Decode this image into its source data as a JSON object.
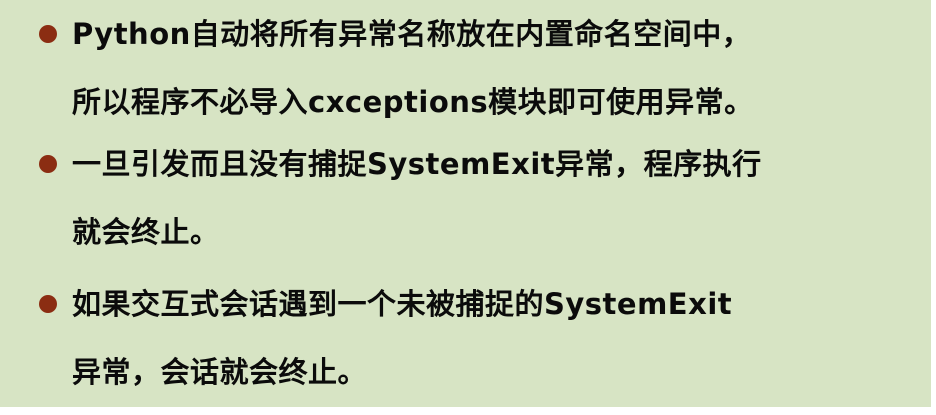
{
  "bullets": [
    {
      "line1": "Python自动将所有异常名称放在内置命名空间中，",
      "line2": "所以程序不必导入cxceptions模块即可使用异常。"
    },
    {
      "line1": "一旦引发而且没有捕捉SystemExit异常，程序执行",
      "line2": "就会终止。"
    },
    {
      "line1": "如果交互式会话遇到一个未被捕捉的SystemExit",
      "line2": "异常，会话就会终止。"
    }
  ],
  "colors": {
    "background": "#d7e4c4",
    "bullet": "#8b2d12",
    "text": "#0b0b0b"
  }
}
